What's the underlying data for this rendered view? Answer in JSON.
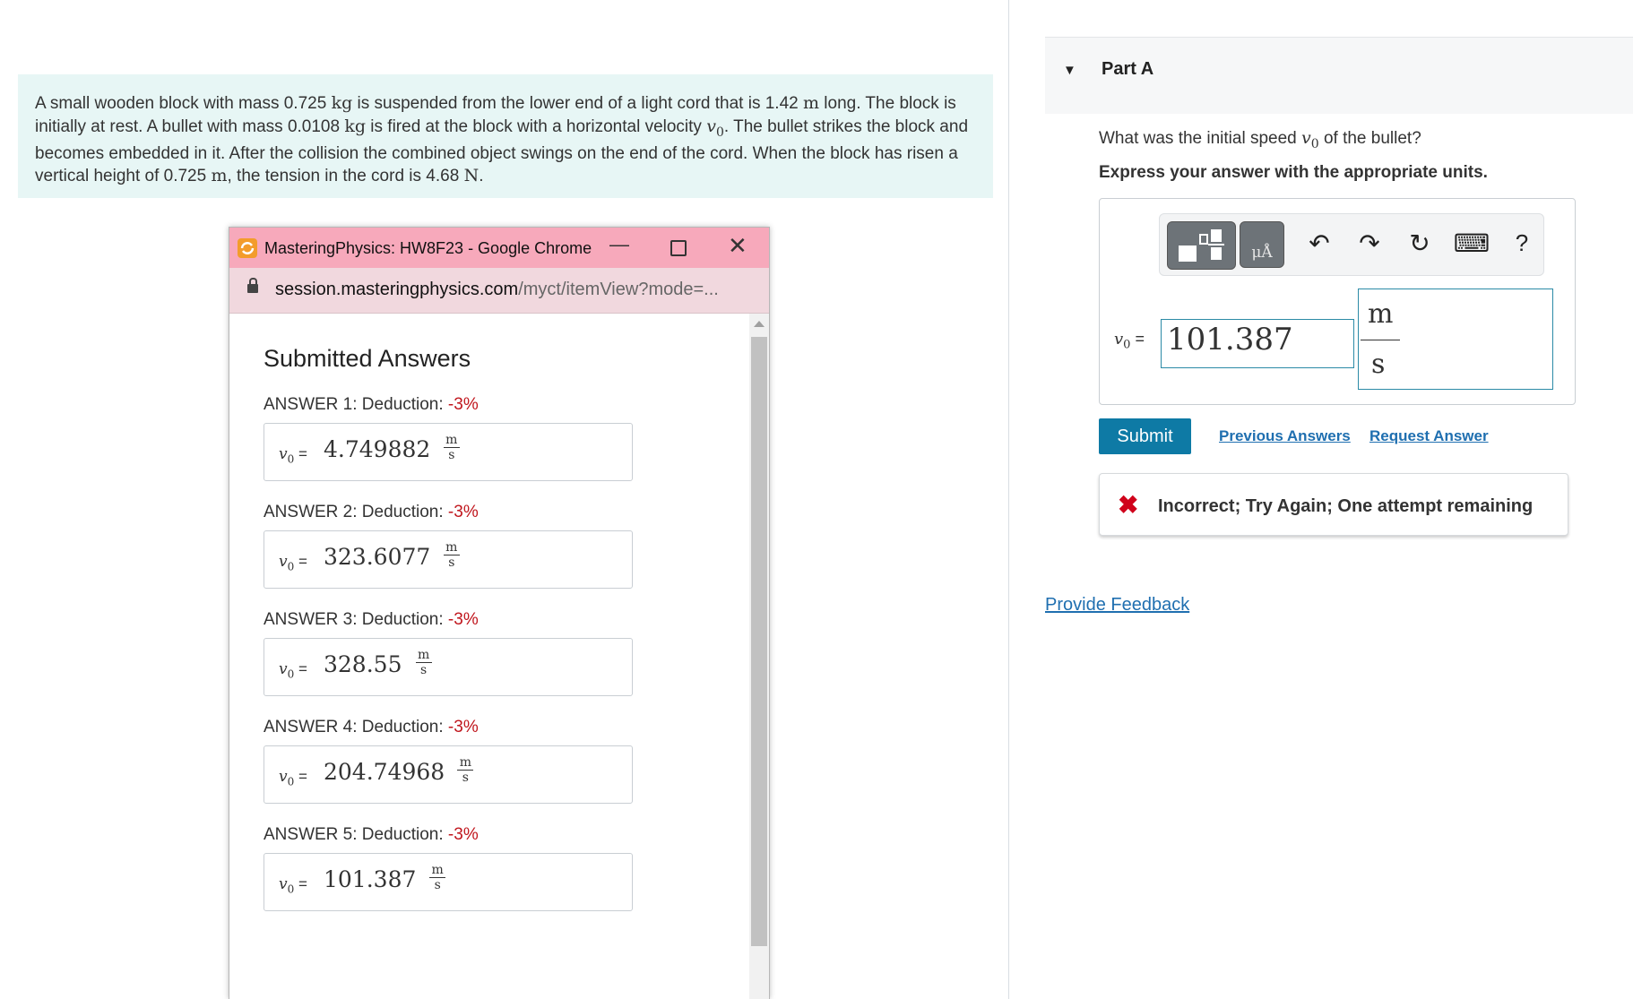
{
  "problem": {
    "segments": [
      {
        "t": "A small wooden block with mass 0.725 ",
        "s": "text"
      },
      {
        "t": "kg",
        "s": "mathr"
      },
      {
        "t": " is suspended from the lower end of a light cord that is 1.42 ",
        "s": "text"
      },
      {
        "t": "m",
        "s": "mathr"
      },
      {
        "t": " long. The block is initially at rest. A bullet with mass 0.0108 ",
        "s": "text"
      },
      {
        "t": "kg",
        "s": "mathr"
      },
      {
        "t": " is fired at the block with a horizontal velocity ",
        "s": "text"
      },
      {
        "t": "v",
        "s": "math"
      },
      {
        "t": "0",
        "s": "mathr"
      },
      {
        "t": ". The bullet strikes the block and becomes embedded in it. After the collision the combined object swings on the end of the cord. When the block has risen a vertical height of 0.725 ",
        "s": "text"
      },
      {
        "t": "m",
        "s": "mathr"
      },
      {
        "t": ", the tension in the cord is 4.68 ",
        "s": "text"
      },
      {
        "t": "N",
        "s": "mathr"
      },
      {
        "t": ".",
        "s": "text"
      }
    ]
  },
  "part": {
    "title": "Part A"
  },
  "question": {
    "prefix": "What was the initial speed ",
    "var": "v",
    "sub": "0",
    "suffix": " of the bullet?"
  },
  "instruction": "Express your answer with the appropriate units.",
  "toolbar": {
    "template_icon": "template-icon",
    "units_label": "μÅ",
    "undo_glyph": "↶",
    "redo_glyph": "↷",
    "reset_glyph": "↻",
    "keyboard_glyph": "⌨",
    "help_label": "?"
  },
  "answer": {
    "var": "v",
    "sub": "0",
    "eq": " =",
    "value": "101.387",
    "unit_num": "m",
    "unit_den": "s"
  },
  "actions": {
    "submit": "Submit",
    "previous": "Previous Answers",
    "request": "Request Answer"
  },
  "feedback": {
    "icon": "✖",
    "text": "Incorrect; Try Again; One attempt remaining"
  },
  "provide_feedback": "Provide Feedback",
  "popup": {
    "title": "MasteringPhysics: HW8F23 - Google Chrome",
    "minimize": "—",
    "close": "✕",
    "url_host": "session.masteringphysics.com",
    "url_path": "/myct/itemView?mode=...",
    "heading": "Submitted Answers",
    "answers": [
      {
        "label": "ANSWER 1: Deduction: ",
        "deduction": "-3%",
        "value": "4.749882",
        "unit_num": "m",
        "unit_den": "s"
      },
      {
        "label": "ANSWER 2: Deduction: ",
        "deduction": "-3%",
        "value": "323.6077",
        "unit_num": "m",
        "unit_den": "s"
      },
      {
        "label": "ANSWER 3: Deduction: ",
        "deduction": "-3%",
        "value": "328.55",
        "unit_num": "m",
        "unit_den": "s"
      },
      {
        "label": "ANSWER 4: Deduction: ",
        "deduction": "-3%",
        "value": "204.74968",
        "unit_num": "m",
        "unit_den": "s"
      },
      {
        "label": "ANSWER 5: Deduction: ",
        "deduction": "-3%",
        "value": "101.387",
        "unit_num": "m",
        "unit_den": "s"
      }
    ],
    "answer_var": "v",
    "answer_sub": "0",
    "answer_eq": " ="
  },
  "colors": {
    "accent": "#0e7aa5",
    "problem_bg": "#e7f6f5",
    "titlebar": "#f7a9bb",
    "error": "#d0021b",
    "deduction": "#c0161d"
  }
}
